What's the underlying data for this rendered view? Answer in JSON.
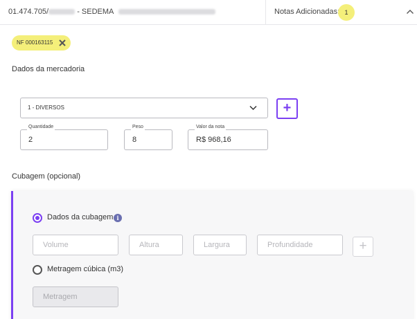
{
  "header": {
    "company_prefix": "01.474.705/",
    "company_suffix": "- SEDEMA",
    "notas_label": "Notas Adicionadas:",
    "notas_count": "1"
  },
  "nf_chip": {
    "label": "NF 000163115"
  },
  "mercadoria": {
    "title": "Dados da mercadoria",
    "select_value": "1 - DIVERSOS",
    "add_label": "+",
    "quantidade_label": "Quantidade",
    "quantidade_value": "2",
    "peso_label": "Peso",
    "peso_value": "8",
    "valor_label": "Valor da nota",
    "valor_value": "R$ 968,16"
  },
  "cubagem": {
    "title": "Cubagem (opcional)",
    "dados_label": "Dados da cubagem",
    "info_glyph": "i",
    "volume_placeholder": "Volume",
    "altura_placeholder": "Altura",
    "largura_placeholder": "Largura",
    "profundidade_placeholder": "Profundidade",
    "add_label": "+",
    "metragem_label": "Metragem cúbica (m3)",
    "metragem_placeholder": "Metragem",
    "selected_option": "dados"
  },
  "colors": {
    "accent": "#7b3ff2",
    "badge": "#f4ef7a",
    "info": "#6a6fb0"
  },
  "icons": {
    "header_toggle": "chevron-up-icon",
    "chip_remove": "close-circle-icon",
    "select_toggle": "chevron-down-icon",
    "info": "info-icon"
  }
}
